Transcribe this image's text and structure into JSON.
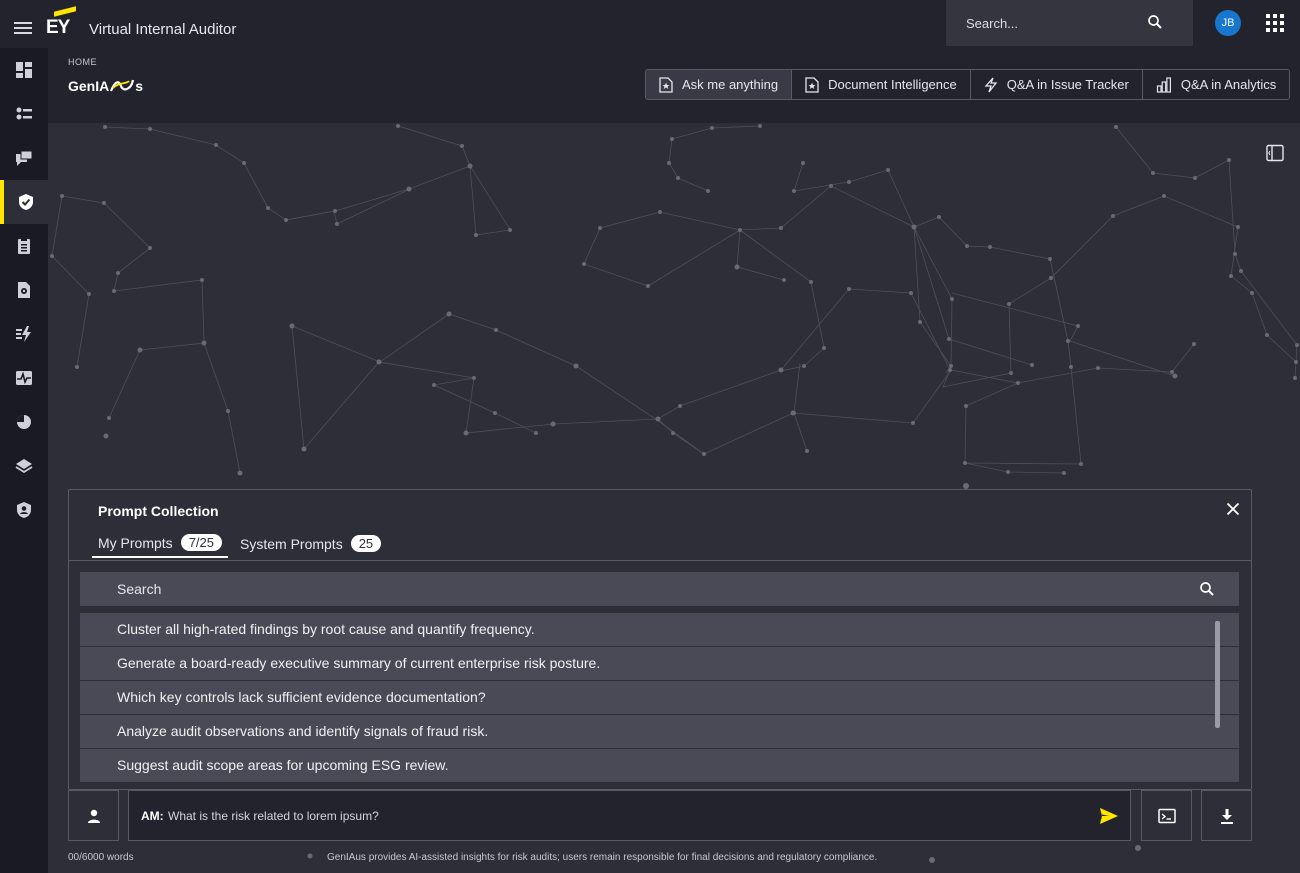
{
  "header": {
    "logo_text": "EY",
    "app_title": "Virtual Internal Auditor",
    "search_placeholder": "Search...",
    "avatar_initials": "JB"
  },
  "breadcrumb": "HOME",
  "page_title_prefix": "GenIA",
  "page_title_suffix": "s",
  "mode_tabs": [
    {
      "label": "Ask me anything",
      "icon": "document-star-icon",
      "active": true
    },
    {
      "label": "Document Intelligence",
      "icon": "document-star-icon",
      "active": false
    },
    {
      "label": "Q&A in Issue Tracker",
      "icon": "lightning-icon",
      "active": false
    },
    {
      "label": "Q&A in Analytics",
      "icon": "bar-chart-icon",
      "active": false
    }
  ],
  "sidebar_icons": [
    "dashboard-icon",
    "workflow-icon",
    "chat-icon",
    "shield-check-icon",
    "clipboard-icon",
    "document-gear-icon",
    "lightning-list-icon",
    "pulse-icon",
    "pie-chart-icon",
    "layers-icon",
    "user-shield-icon"
  ],
  "prompt_collection": {
    "title": "Prompt Collection",
    "tabs": [
      {
        "label": "My Prompts",
        "count": "7/25"
      },
      {
        "label": "System Prompts",
        "count": "25"
      }
    ],
    "search_placeholder": "Search",
    "prompts": [
      "Cluster all high-rated findings by root cause and quantify frequency.",
      "Generate a board-ready executive summary of current enterprise risk posture.",
      "Which key controls lack sufficient evidence documentation?",
      "Analyze audit observations and identify signals of fraud risk.",
      "Suggest audit scope areas for upcoming ESG review."
    ]
  },
  "composer": {
    "prefix": "AM:",
    "message": "What is the risk related to lorem ipsum?"
  },
  "footer": {
    "word_count": "00/6000 words",
    "disclaimer": "GenIAus provides AI-assisted insights for risk audits; users remain responsible for final decisions and regulatory compliance."
  },
  "colors": {
    "accent": "#ffe600",
    "background": "#2e2e38",
    "topbar": "#23232e",
    "avatar": "#1777cf"
  }
}
